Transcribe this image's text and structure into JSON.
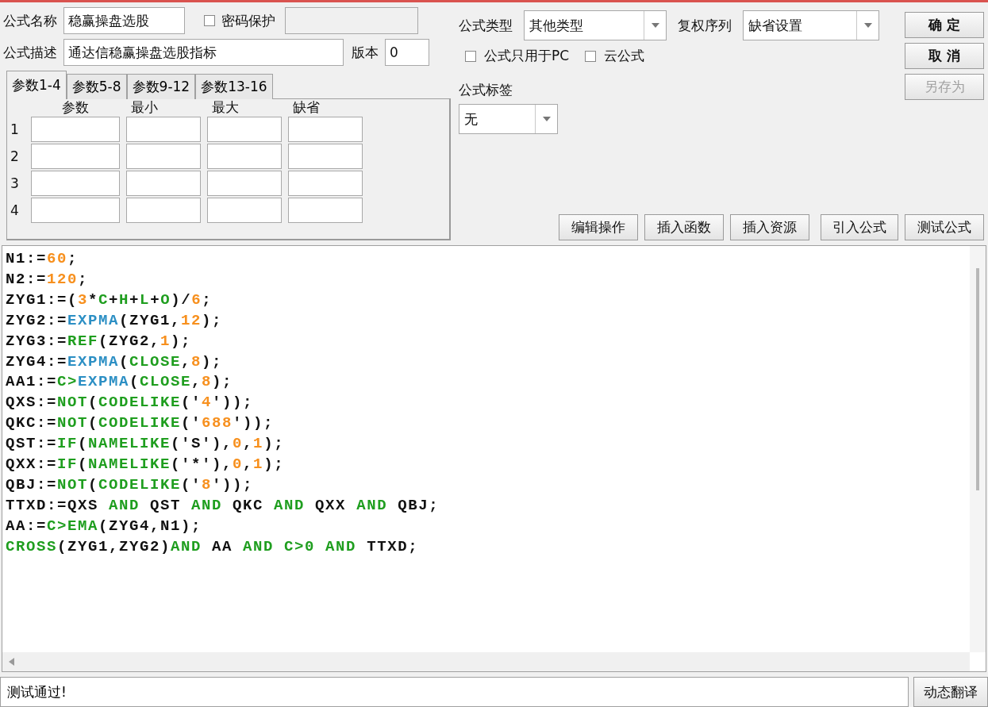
{
  "name_field": {
    "label": "公式名称",
    "value": "稳赢操盘选股"
  },
  "password": {
    "label": "密码保护",
    "checked": false
  },
  "description_field": {
    "label": "公式描述",
    "value": "通达信稳赢操盘选股指标"
  },
  "version_field": {
    "label": "版本",
    "value": "0"
  },
  "param_tabs": [
    {
      "label": "参数1-4",
      "selected": true
    },
    {
      "label": "参数5-8",
      "selected": false
    },
    {
      "label": "参数9-12",
      "selected": false
    },
    {
      "label": "参数13-16",
      "selected": false
    }
  ],
  "param_columns": [
    "参数",
    "最小",
    "最大",
    "缺省"
  ],
  "param_rows": [
    "1",
    "2",
    "3",
    "4"
  ],
  "formula_type": {
    "label": "公式类型",
    "value": "其他类型"
  },
  "restoration": {
    "label": "复权序列",
    "value": "缺省设置"
  },
  "options": [
    {
      "label": "公式只用于PC",
      "checked": false
    },
    {
      "label": "云公式",
      "checked": false
    }
  ],
  "formula_tag": {
    "label": "公式标签",
    "value": "无"
  },
  "side_buttons": [
    {
      "label": "确 定",
      "disabled": false
    },
    {
      "label": "取 消",
      "disabled": false
    },
    {
      "label": "另存为",
      "disabled": true
    }
  ],
  "tool_buttons": [
    "编辑操作",
    "插入函数",
    "插入资源",
    "引入公式",
    "测试公式"
  ],
  "code_lines": [
    [
      {
        "kind": "text",
        "text": "N1:="
      },
      {
        "kind": "number",
        "text": "60"
      },
      {
        "kind": "text",
        "text": ";"
      }
    ],
    [
      {
        "kind": "text",
        "text": "N2:="
      },
      {
        "kind": "number",
        "text": "120"
      },
      {
        "kind": "text",
        "text": ";"
      }
    ],
    [
      {
        "kind": "text",
        "text": "ZYG1:=("
      },
      {
        "kind": "number",
        "text": "3"
      },
      {
        "kind": "text",
        "text": "*"
      },
      {
        "kind": "keyword",
        "text": "C"
      },
      {
        "kind": "text",
        "text": "+"
      },
      {
        "kind": "keyword",
        "text": "H"
      },
      {
        "kind": "text",
        "text": "+"
      },
      {
        "kind": "keyword",
        "text": "L"
      },
      {
        "kind": "text",
        "text": "+"
      },
      {
        "kind": "keyword",
        "text": "O"
      },
      {
        "kind": "text",
        "text": ")/"
      },
      {
        "kind": "number",
        "text": "6"
      },
      {
        "kind": "text",
        "text": ";"
      }
    ],
    [
      {
        "kind": "text",
        "text": "ZYG2:="
      },
      {
        "kind": "function",
        "text": "EXPMA"
      },
      {
        "kind": "text",
        "text": "(ZYG1,"
      },
      {
        "kind": "number",
        "text": "12"
      },
      {
        "kind": "text",
        "text": ");"
      }
    ],
    [
      {
        "kind": "text",
        "text": "ZYG3:="
      },
      {
        "kind": "keyword",
        "text": "REF"
      },
      {
        "kind": "text",
        "text": "(ZYG2,"
      },
      {
        "kind": "number",
        "text": "1"
      },
      {
        "kind": "text",
        "text": ");"
      }
    ],
    [
      {
        "kind": "text",
        "text": "ZYG4:="
      },
      {
        "kind": "function",
        "text": "EXPMA"
      },
      {
        "kind": "text",
        "text": "("
      },
      {
        "kind": "keyword",
        "text": "CLOSE"
      },
      {
        "kind": "text",
        "text": ","
      },
      {
        "kind": "number",
        "text": "8"
      },
      {
        "kind": "text",
        "text": ");"
      }
    ],
    [
      {
        "kind": "text",
        "text": "AA1:="
      },
      {
        "kind": "keyword",
        "text": "C>"
      },
      {
        "kind": "function",
        "text": "EXPMA"
      },
      {
        "kind": "text",
        "text": "("
      },
      {
        "kind": "keyword",
        "text": "CLOSE"
      },
      {
        "kind": "text",
        "text": ","
      },
      {
        "kind": "number",
        "text": "8"
      },
      {
        "kind": "text",
        "text": ");"
      }
    ],
    [
      {
        "kind": "text",
        "text": "QXS:="
      },
      {
        "kind": "keyword",
        "text": "NOT"
      },
      {
        "kind": "text",
        "text": "("
      },
      {
        "kind": "keyword",
        "text": "CODELIKE"
      },
      {
        "kind": "text",
        "text": "('"
      },
      {
        "kind": "number",
        "text": "4"
      },
      {
        "kind": "text",
        "text": "'));"
      }
    ],
    [
      {
        "kind": "text",
        "text": "QKC:="
      },
      {
        "kind": "keyword",
        "text": "NOT"
      },
      {
        "kind": "text",
        "text": "("
      },
      {
        "kind": "keyword",
        "text": "CODELIKE"
      },
      {
        "kind": "text",
        "text": "('"
      },
      {
        "kind": "number",
        "text": "688"
      },
      {
        "kind": "text",
        "text": "'));"
      }
    ],
    [
      {
        "kind": "text",
        "text": "QST:="
      },
      {
        "kind": "keyword",
        "text": "IF"
      },
      {
        "kind": "text",
        "text": "("
      },
      {
        "kind": "keyword",
        "text": "NAMELIKE"
      },
      {
        "kind": "text",
        "text": "('S'),"
      },
      {
        "kind": "number",
        "text": "0"
      },
      {
        "kind": "text",
        "text": ","
      },
      {
        "kind": "number",
        "text": "1"
      },
      {
        "kind": "text",
        "text": ");"
      }
    ],
    [
      {
        "kind": "text",
        "text": "QXX:="
      },
      {
        "kind": "keyword",
        "text": "IF"
      },
      {
        "kind": "text",
        "text": "("
      },
      {
        "kind": "keyword",
        "text": "NAMELIKE"
      },
      {
        "kind": "text",
        "text": "('*'),"
      },
      {
        "kind": "number",
        "text": "0"
      },
      {
        "kind": "text",
        "text": ","
      },
      {
        "kind": "number",
        "text": "1"
      },
      {
        "kind": "text",
        "text": ");"
      }
    ],
    [
      {
        "kind": "text",
        "text": "QBJ:="
      },
      {
        "kind": "keyword",
        "text": "NOT"
      },
      {
        "kind": "text",
        "text": "("
      },
      {
        "kind": "keyword",
        "text": "CODELIKE"
      },
      {
        "kind": "text",
        "text": "('"
      },
      {
        "kind": "number",
        "text": "8"
      },
      {
        "kind": "text",
        "text": "'));"
      }
    ],
    [
      {
        "kind": "text",
        "text": "TTXD:=QXS "
      },
      {
        "kind": "keyword",
        "text": "AND"
      },
      {
        "kind": "text",
        "text": " QST "
      },
      {
        "kind": "keyword",
        "text": "AND"
      },
      {
        "kind": "text",
        "text": " QKC "
      },
      {
        "kind": "keyword",
        "text": "AND"
      },
      {
        "kind": "text",
        "text": " QXX "
      },
      {
        "kind": "keyword",
        "text": "AND"
      },
      {
        "kind": "text",
        "text": " QBJ;"
      }
    ],
    [
      {
        "kind": "text",
        "text": "AA:="
      },
      {
        "kind": "keyword",
        "text": "C>"
      },
      {
        "kind": "keyword",
        "text": "EMA"
      },
      {
        "kind": "text",
        "text": "(ZYG4,N1);"
      }
    ],
    [
      {
        "kind": "keyword",
        "text": "CROSS"
      },
      {
        "kind": "text",
        "text": "(ZYG1,ZYG2)"
      },
      {
        "kind": "keyword",
        "text": "AND"
      },
      {
        "kind": "text",
        "text": " AA "
      },
      {
        "kind": "keyword",
        "text": "AND"
      },
      {
        "kind": "keyword",
        "text": " C>0 "
      },
      {
        "kind": "keyword",
        "text": "AND"
      },
      {
        "kind": "text",
        "text": " TTXD;"
      }
    ]
  ],
  "status": {
    "message": "测试通过!",
    "button": "动态翻译"
  }
}
